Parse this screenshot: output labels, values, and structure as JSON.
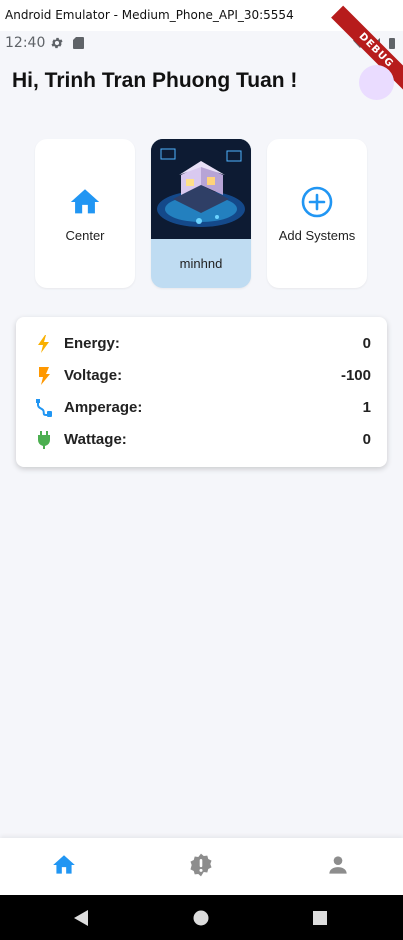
{
  "window": {
    "title": "Android Emulator - Medium_Phone_API_30:5554"
  },
  "status_bar": {
    "time": "12:40",
    "icons_left": [
      "gear-icon",
      "sd-card-icon"
    ],
    "icons_right": [
      "wifi-icon",
      "signal-icon",
      "battery-icon"
    ]
  },
  "debug_banner": "DEBUG",
  "header": {
    "greeting": "Hi, Trinh Tran Phuong Tuan !"
  },
  "cards": {
    "center": {
      "label": "Center",
      "icon": "home-icon"
    },
    "system": {
      "label": "minhnd",
      "image": "smart-home-illustration"
    },
    "add": {
      "label": "Add Systems",
      "icon": "add-circle-icon"
    }
  },
  "metrics": [
    {
      "label": "Energy:",
      "value": "0",
      "icon": "bolt-icon"
    },
    {
      "label": "Voltage:",
      "value": "-100",
      "icon": "flash-icon"
    },
    {
      "label": "Amperage:",
      "value": "1",
      "icon": "cable-icon"
    },
    {
      "label": "Wattage:",
      "value": "0",
      "icon": "plug-icon"
    }
  ],
  "bottom_nav": [
    "home-icon",
    "alert-icon",
    "person-icon"
  ],
  "colors": {
    "accent": "#2196f3",
    "energy": "#f9b000",
    "voltage": "#ff9800",
    "amperage": "#2196f3",
    "wattage": "#4caf50",
    "debug": "#b71c1c"
  }
}
